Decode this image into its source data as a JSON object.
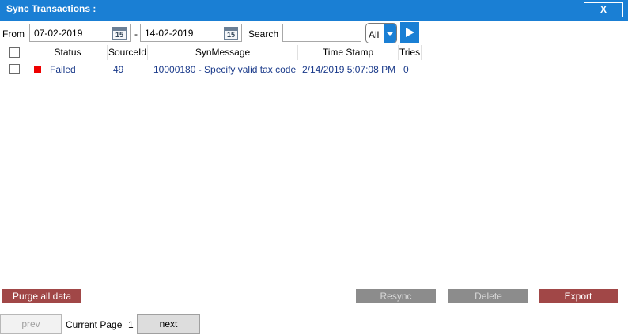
{
  "window": {
    "title": "Sync Transactions :",
    "close_label": "X"
  },
  "filter": {
    "from_label": "From",
    "from_date": "07-02-2019",
    "date_separator": "-",
    "to_date": "14-02-2019",
    "calendar_icon_text": "15",
    "search_label": "Search",
    "search_value": "",
    "status_filter": "All"
  },
  "grid": {
    "columns": [
      "Status",
      "SourceId",
      "SynMessage",
      "Time Stamp",
      "Tries"
    ],
    "rows": [
      {
        "status": "Failed",
        "status_color": "#ee0000",
        "source_id": "49",
        "message": "10000180 - Specify valid tax code",
        "timestamp": "2/14/2019 5:07:08 PM",
        "tries": "0"
      }
    ]
  },
  "actions": {
    "purge": "Purge all data",
    "resync": "Resync",
    "delete": "Delete",
    "export": "Export"
  },
  "pager": {
    "prev": "prev",
    "current_page_label": "Current Page",
    "current_page": "1",
    "next": "next"
  },
  "colors": {
    "accent": "#1a7fd4",
    "danger": "#a14747",
    "disabled": "#8c8c8c"
  }
}
